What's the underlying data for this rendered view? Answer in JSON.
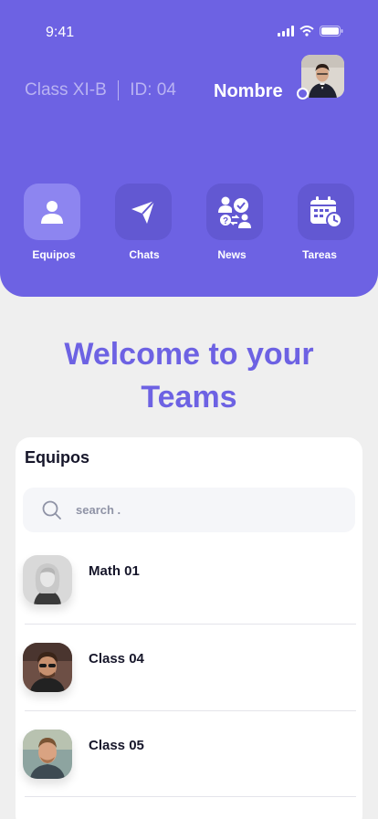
{
  "status": {
    "time": "9:41"
  },
  "profile": {
    "class": "Class XI-B",
    "id_label": "ID: 04",
    "name": "Nombre"
  },
  "nav": [
    {
      "label": "Equipos",
      "icon": "user-icon",
      "active": true
    },
    {
      "label": "Chats",
      "icon": "send-icon",
      "active": false
    },
    {
      "label": "News",
      "icon": "people-check-icon",
      "active": false
    },
    {
      "label": "Tareas",
      "icon": "calendar-clock-icon",
      "active": false
    }
  ],
  "welcome": {
    "line1": "Welcome to your",
    "line2": "Teams"
  },
  "teams_card": {
    "title": "Equipos",
    "search_placeholder": "search .",
    "items": [
      {
        "name": "Math 01"
      },
      {
        "name": "Class 04"
      },
      {
        "name": "Class 05"
      }
    ]
  },
  "colors": {
    "accent": "#6d62e3",
    "background": "#efefef",
    "card": "#ffffff"
  }
}
